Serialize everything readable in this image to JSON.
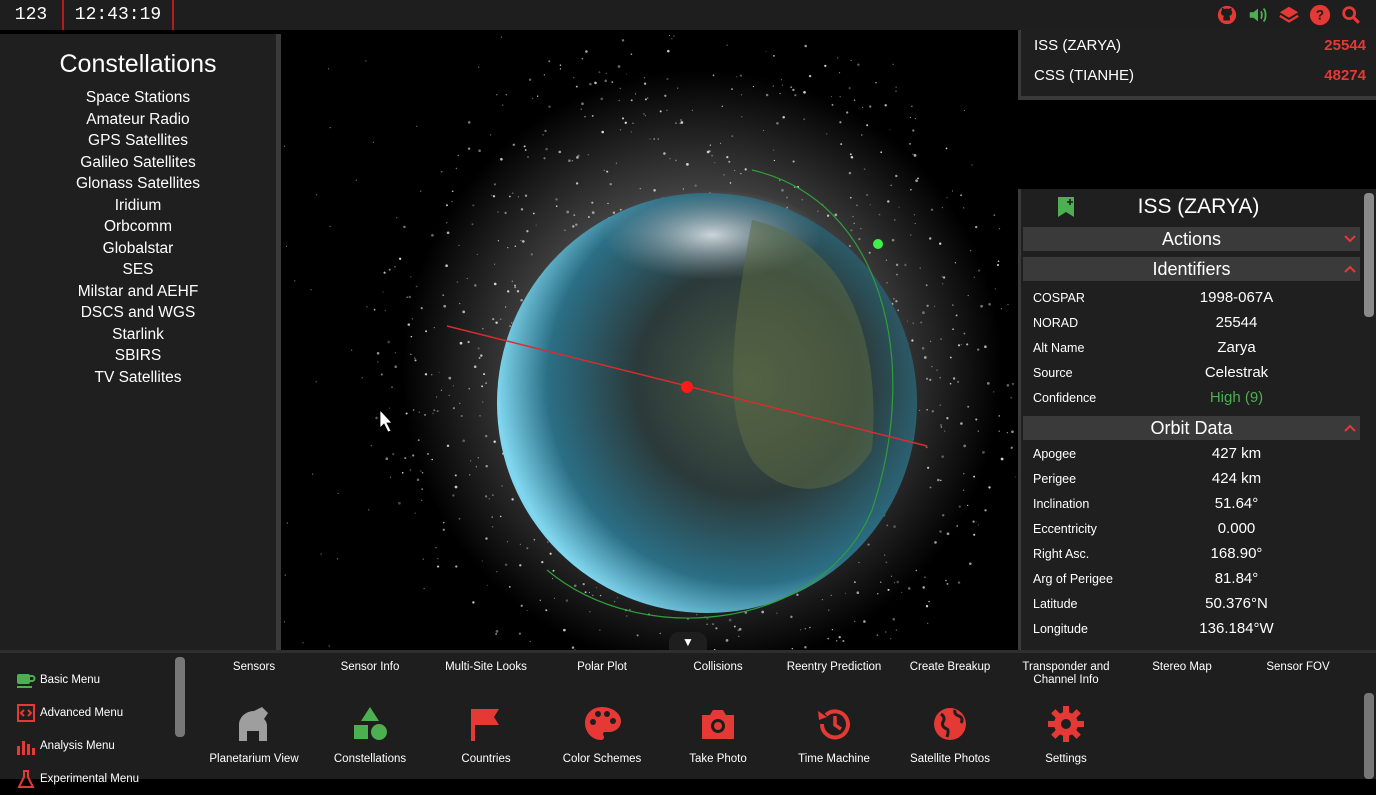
{
  "topbar": {
    "counter": "123",
    "clock": "12:43:19"
  },
  "top_icons": [
    "github-icon",
    "sound-icon",
    "layers-icon",
    "help-icon",
    "search-icon"
  ],
  "constellations": {
    "title": "Constellations",
    "items": [
      "Space Stations",
      "Amateur Radio",
      "GPS Satellites",
      "Galileo Satellites",
      "Glonass Satellites",
      "Iridium",
      "Orbcomm",
      "Globalstar",
      "SES",
      "Milstar and AEHF",
      "DSCS and WGS",
      "Starlink",
      "SBIRS",
      "TV Satellites"
    ]
  },
  "watchlist": [
    {
      "name": "ISS (ZARYA)",
      "id": "25544"
    },
    {
      "name": "CSS (TIANHE)",
      "id": "48274"
    }
  ],
  "satellite": {
    "name": "ISS (ZARYA)",
    "actions_label": "Actions",
    "identifiers_label": "Identifiers",
    "identifiers": [
      {
        "k": "COSPAR",
        "v": "1998-067A"
      },
      {
        "k": "NORAD",
        "v": "25544"
      },
      {
        "k": "Alt Name",
        "v": "Zarya"
      },
      {
        "k": "Source",
        "v": "Celestrak"
      },
      {
        "k": "Confidence",
        "v": "High (9)"
      }
    ],
    "orbit_label": "Orbit Data",
    "orbit": [
      {
        "k": "Apogee",
        "v": "427 km"
      },
      {
        "k": "Perigee",
        "v": "424 km"
      },
      {
        "k": "Inclination",
        "v": "51.64°"
      },
      {
        "k": "Eccentricity",
        "v": "0.000"
      },
      {
        "k": "Right Asc.",
        "v": "168.90°"
      },
      {
        "k": "Arg of Perigee",
        "v": "81.84°"
      },
      {
        "k": "Latitude",
        "v": "50.376°N"
      },
      {
        "k": "Longitude",
        "v": "136.184°W"
      }
    ]
  },
  "bottom_menu": {
    "left_items": [
      "Basic Menu",
      "Advanced Menu",
      "Analysis Menu",
      "Experimental Menu"
    ],
    "top_labels": [
      "Sensors",
      "Sensor Info",
      "Multi-Site Looks",
      "Polar Plot",
      "Collisions",
      "Reentry Prediction",
      "Create Breakup",
      "Transponder and Channel Info",
      "Stereo Map",
      "Sensor FOV"
    ],
    "icon_tiles": [
      "Planetarium View",
      "Constellations",
      "Countries",
      "Color Schemes",
      "Take Photo",
      "Time Machine",
      "Satellite Photos",
      "Settings"
    ]
  },
  "colors": {
    "accent": "#e53935",
    "highlight": "#4caf50",
    "panel": "#1f1f1f",
    "section": "#3a3a3a"
  }
}
